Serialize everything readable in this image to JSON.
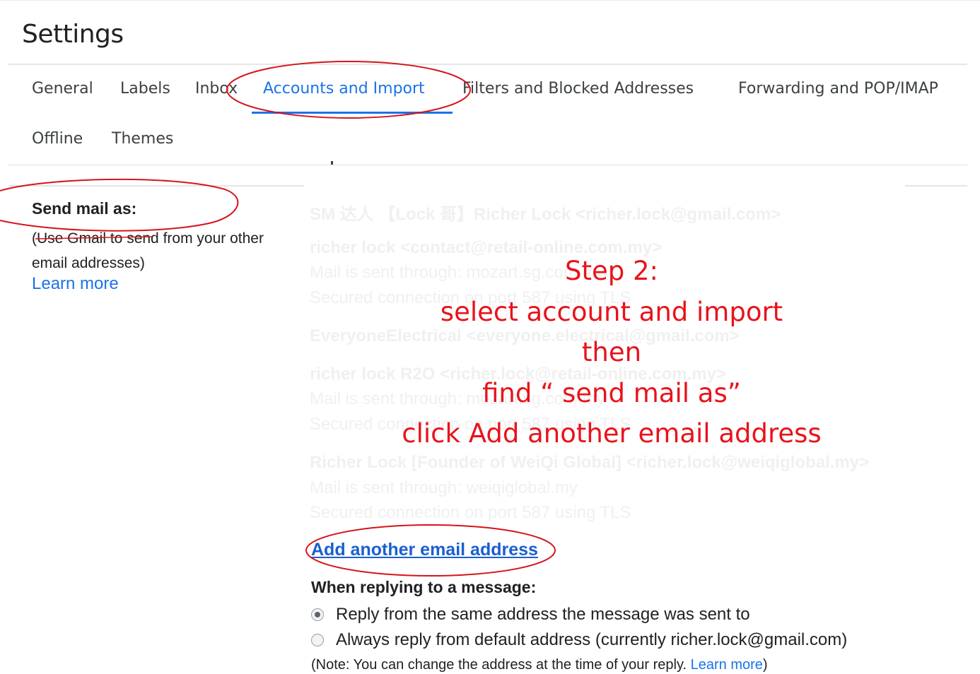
{
  "page": {
    "title": "Settings"
  },
  "tabs": [
    {
      "label": "General",
      "active": false
    },
    {
      "label": "Labels",
      "active": false
    },
    {
      "label": "Inbox",
      "active": false
    },
    {
      "label": "Accounts and Import",
      "active": true
    },
    {
      "label": "Filters and Blocked Addresses",
      "active": false
    },
    {
      "label": "Forwarding and POP/IMAP",
      "active": false
    },
    {
      "label": "Offline",
      "active": false
    },
    {
      "label": "Themes",
      "active": false
    }
  ],
  "send_mail_as": {
    "label": "Send mail as:",
    "description": "(Use Gmail to send from your other email addresses)",
    "learn_more": "Learn more"
  },
  "faded_accounts": [
    "SM 达人 【Lock 哥】Richer Lock <richer.lock@gmail.com>",
    "richer lock <contact@retail-online.com.my>",
    "Mail is sent through: mozart.sg.com.my",
    "Secured connection on port 587 using TLS",
    "EveryoneElectrical <everyone.electrical@gmail.com>",
    "richer lock R2O <richer.lock@retail-online.com.my>",
    "Mail is sent through: mozart.sg.com.my",
    "Secured connection on port 587 using TLS",
    "Richer Lock [Founder of WeiQi Global] <richer.lock@weiqiglobal.my>",
    "Mail is sent through: weiqiglobal.my",
    "Secured connection on port 587 using TLS"
  ],
  "add_another_email": "Add another email address",
  "reply": {
    "heading": "When replying to a message:",
    "options": [
      {
        "label": "Reply from the same address the message was sent to",
        "selected": true
      },
      {
        "label": "Always reply from default address (currently richer.lock@gmail.com)",
        "selected": false
      }
    ],
    "note_prefix": "(Note: You can change the address at the time of your reply. ",
    "note_link": "Learn more",
    "note_suffix": ")"
  },
  "annotation": {
    "lines": [
      "Step 2:",
      "select account and import",
      "then",
      "find “ send mail as”",
      "click Add another email address"
    ],
    "color": "#e8131b"
  },
  "colors": {
    "accent": "#1a73e8",
    "link": "#1a5fd0",
    "annotation": "#e8131b"
  }
}
